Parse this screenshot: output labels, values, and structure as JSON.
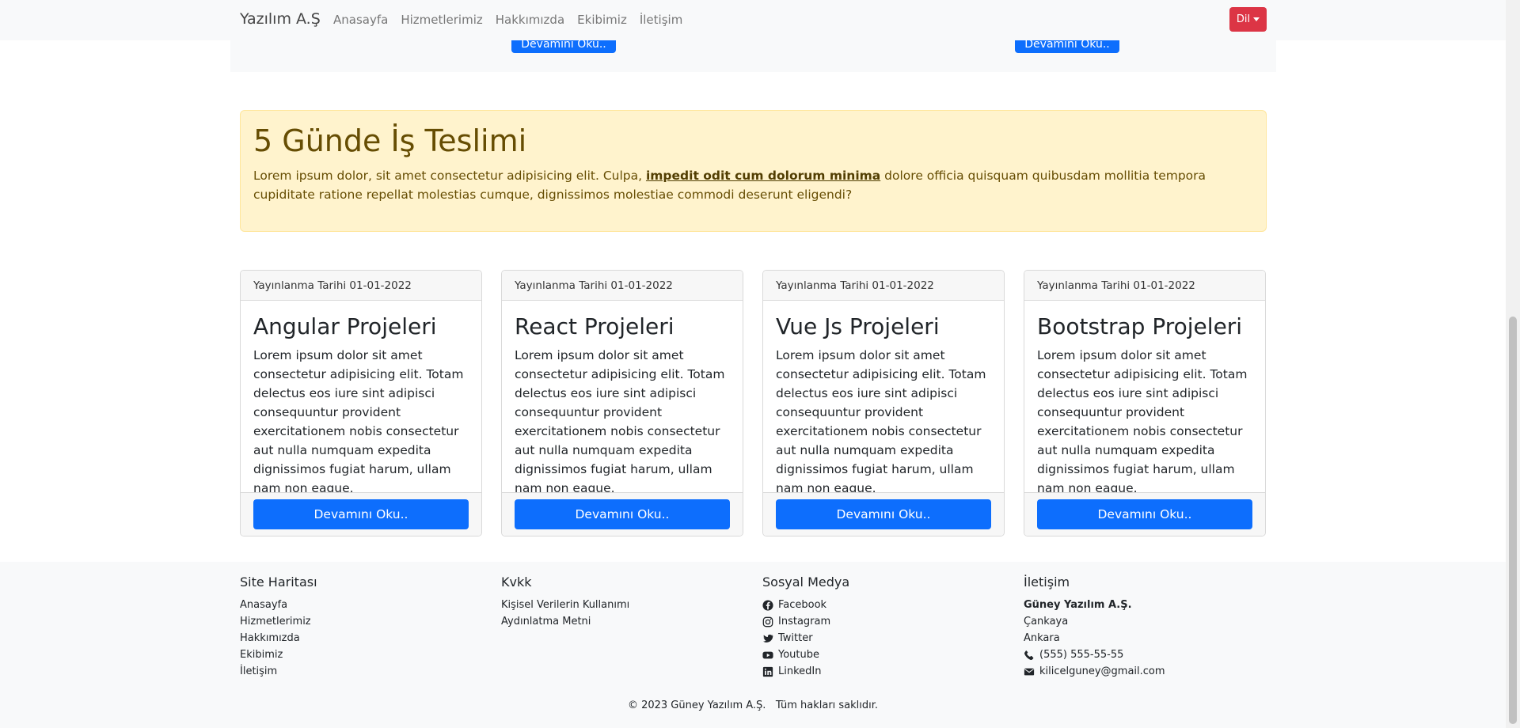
{
  "navbar": {
    "brand": "Yazılım A.Ş",
    "links": [
      "Anasayfa",
      "Hizmetlerimiz",
      "Hakkımızda",
      "Ekibimiz",
      "İletişim"
    ],
    "lang_label": "Dil"
  },
  "top_section": {
    "button_label": "Devamını Oku.."
  },
  "alert": {
    "title": "5 Günde İş Teslimi",
    "text_before": "Lorem ipsum dolor, sit amet consectetur adipisicing elit. Culpa, ",
    "link_text": "impedit odit cum dolorum minima",
    "text_after": " dolore officia quisquam quibusdam mollitia tempora cupiditate ratione repellat molestias cumque, dignissimos molestiae commodi deserunt eligendi?"
  },
  "cards": [
    {
      "header": "Yayınlanma Tarihi 01-01-2022",
      "title": "Angular Projeleri",
      "text": "Lorem ipsum dolor sit amet consectetur adipisicing elit. Totam delectus eos iure sint adipisci consequuntur provident exercitationem nobis consectetur aut nulla numquam expedita dignissimos fugiat harum, ullam nam non eaque.",
      "button": "Devamını Oku.."
    },
    {
      "header": "Yayınlanma Tarihi 01-01-2022",
      "title": "React Projeleri",
      "text": "Lorem ipsum dolor sit amet consectetur adipisicing elit. Totam delectus eos iure sint adipisci consequuntur provident exercitationem nobis consectetur aut nulla numquam expedita dignissimos fugiat harum, ullam nam non eaque.",
      "button": "Devamını Oku.."
    },
    {
      "header": "Yayınlanma Tarihi 01-01-2022",
      "title": "Vue Js Projeleri",
      "text": "Lorem ipsum dolor sit amet consectetur adipisicing elit. Totam delectus eos iure sint adipisci consequuntur provident exercitationem nobis consectetur aut nulla numquam expedita dignissimos fugiat harum, ullam nam non eaque.",
      "button": "Devamını Oku.."
    },
    {
      "header": "Yayınlanma Tarihi 01-01-2022",
      "title": "Bootstrap Projeleri",
      "text": "Lorem ipsum dolor sit amet consectetur adipisicing elit. Totam delectus eos iure sint adipisci consequuntur provident exercitationem nobis consectetur aut nulla numquam expedita dignissimos fugiat harum, ullam nam non eaque.",
      "button": "Devamını Oku.."
    }
  ],
  "footer": {
    "sitemap": {
      "title": "Site Haritası",
      "items": [
        "Anasayfa",
        "Hizmetlerimiz",
        "Hakkımızda",
        "Ekibimiz",
        "İletişim"
      ]
    },
    "kvkk": {
      "title": "Kvkk",
      "items": [
        "Kişisel Verilerin Kullanımı",
        "Aydınlatma Metni"
      ]
    },
    "social": {
      "title": "Sosyal Medya",
      "items": [
        "Facebook",
        "Instagram",
        "Twitter",
        "Youtube",
        "LinkedIn"
      ]
    },
    "contact": {
      "title": "İletişim",
      "company": "Güney Yazılım A.Ş.",
      "district": "Çankaya",
      "city": "Ankara",
      "phone": "(555) 555-55-55",
      "email": "kilicelguney@gmail.com"
    },
    "copyright": "© 2023 Güney Yazılım A.Ş.   Tüm hakları saklıdır."
  },
  "colors": {
    "primary": "#0d6efd",
    "danger": "#dc3545",
    "warning_bg": "#fff3cd",
    "warning_text": "#664d03"
  }
}
